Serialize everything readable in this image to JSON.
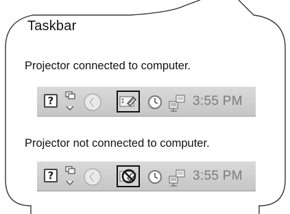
{
  "callout": {
    "title": "Taskbar"
  },
  "connected": {
    "caption": "Projector connected to computer.",
    "time": "3:55 PM",
    "status_icon": "projector-connected-icon"
  },
  "disconnected": {
    "caption": "Projector not connected to computer.",
    "time": "3:55 PM",
    "status_icon": "projector-disconnected-icon"
  },
  "colors": {
    "taskbar": "#cfcfcf",
    "border": "#555555",
    "time_text": "#7a7a7a",
    "highlight_box": "#111111"
  }
}
